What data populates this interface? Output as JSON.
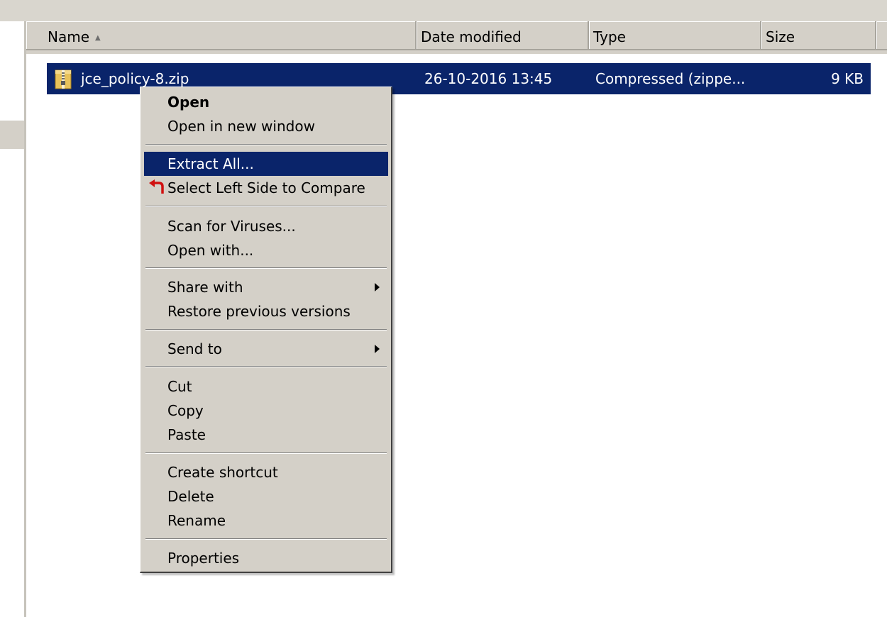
{
  "columns": {
    "name": "Name",
    "date_modified": "Date modified",
    "type": "Type",
    "size": "Size"
  },
  "file": {
    "name": "jce_policy-8.zip",
    "date_modified": "26-10-2016 13:45",
    "type": "Compressed (zippe...",
    "size": "9 KB",
    "icon": "zip-folder-icon"
  },
  "context_menu": {
    "open": "Open",
    "open_new_window": "Open in new window",
    "extract_all": "Extract All...",
    "select_left_side": "Select Left Side to Compare",
    "scan_viruses": "Scan for Viruses...",
    "open_with": "Open with...",
    "share_with": "Share with",
    "restore_versions": "Restore previous versions",
    "send_to": "Send to",
    "cut": "Cut",
    "copy": "Copy",
    "paste": "Paste",
    "create_shortcut": "Create shortcut",
    "delete": "Delete",
    "rename": "Rename",
    "properties": "Properties",
    "highlighted_item": "Extract All..."
  },
  "colors": {
    "selection": "#0a246a",
    "menu_bg": "#d4d0c8",
    "header_bg": "#d4d0c8"
  }
}
